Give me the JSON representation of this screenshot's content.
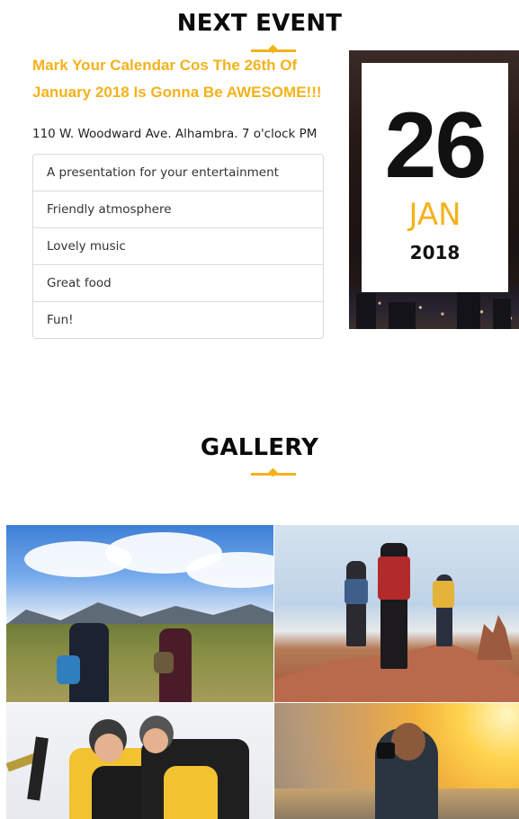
{
  "next_event": {
    "title": "NEXT EVENT",
    "headline": "Mark Your Calendar Cos The 26th Of January 2018 Is Gonna Be AWESOME!!!",
    "location": "110 W. Woodward Ave. Alhambra. 7 o'clock PM",
    "features": [
      "A presentation for your entertainment",
      "Friendly atmosphere",
      "Lovely music",
      "Great food",
      "Fun!"
    ],
    "date": {
      "day": "26",
      "month": "JAN",
      "year": "2018"
    }
  },
  "gallery": {
    "title": "GALLERY"
  },
  "colors": {
    "accent": "#f4b21a",
    "text": "#111111"
  }
}
